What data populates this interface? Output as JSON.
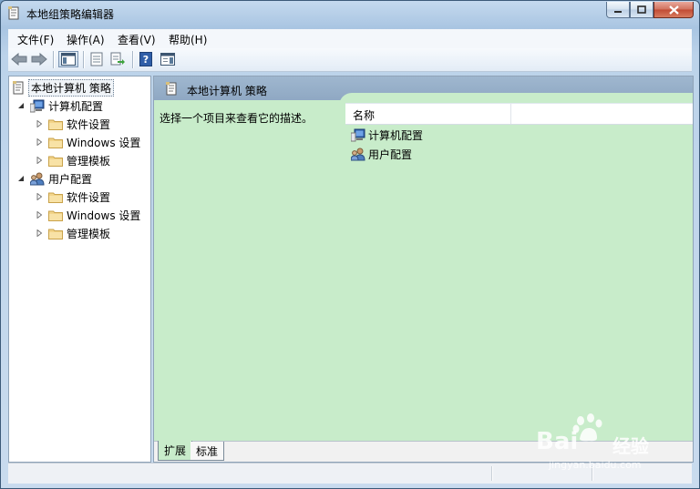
{
  "window": {
    "title": "本地组策略编辑器",
    "controls": [
      "minimize-icon",
      "maximize-icon",
      "close-icon"
    ]
  },
  "menu": {
    "items": [
      {
        "label": "文件(F)"
      },
      {
        "label": "操作(A)"
      },
      {
        "label": "查看(V)"
      },
      {
        "label": "帮助(H)"
      }
    ]
  },
  "toolbar": {
    "buttons": [
      "back-icon",
      "forward-icon",
      "show-hide-tree-icon",
      "properties-icon",
      "export-list-icon",
      "help-icon",
      "action-pane-icon"
    ]
  },
  "tree": {
    "root": "本地计算机 策略",
    "computer": {
      "label": "计算机配置",
      "children": [
        "软件设置",
        "Windows 设置",
        "管理模板"
      ]
    },
    "user": {
      "label": "用户配置",
      "children": [
        "软件设置",
        "Windows 设置",
        "管理模板"
      ]
    }
  },
  "details": {
    "header_title": "本地计算机 策略",
    "description": "选择一个项目来查看它的描述。",
    "column_name": "名称",
    "rows": [
      {
        "label": "计算机配置",
        "icon": "computer-config-icon"
      },
      {
        "label": "用户配置",
        "icon": "user-config-icon"
      }
    ]
  },
  "tabs": {
    "expanded": "扩展",
    "standard": "标准",
    "selected": "扩展"
  },
  "watermark": {
    "brand": "Bai",
    "brand_cn": "经验",
    "url": "jingyan.baidu.com"
  },
  "colors": {
    "accent": "#8fa8c3",
    "content_bg": "#c8ecca",
    "close_btn": "#c14a33"
  }
}
